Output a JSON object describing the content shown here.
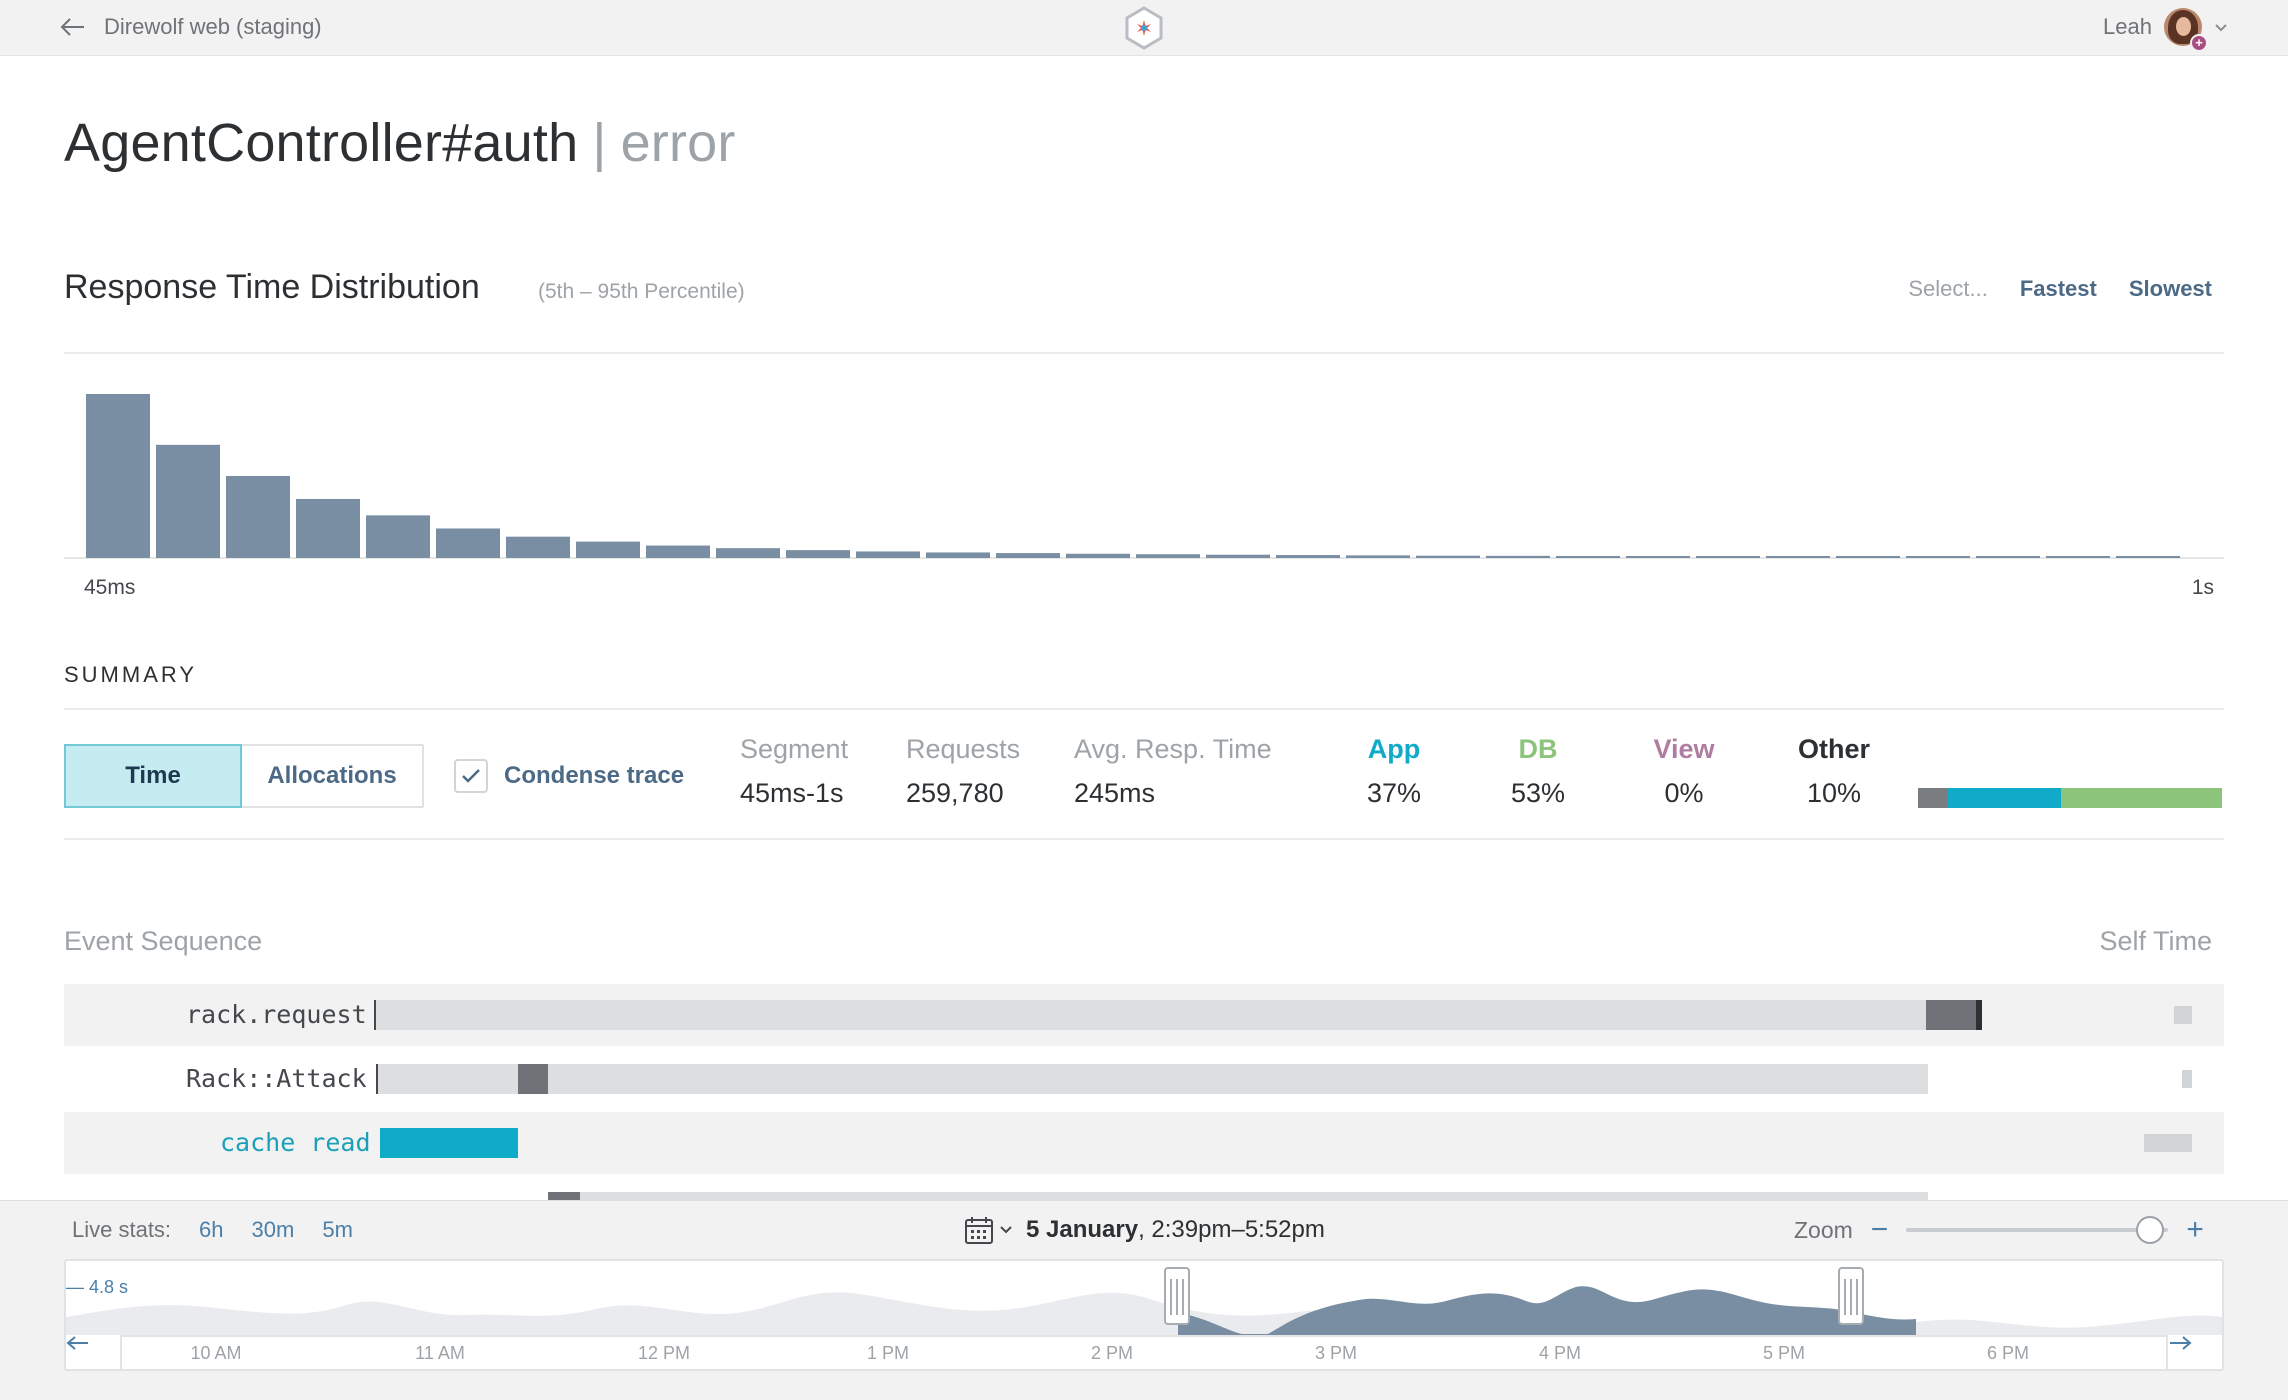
{
  "topbar": {
    "app_name": "Direwolf web (staging)",
    "user_name": "Leah"
  },
  "page": {
    "endpoint": "AgentController#auth",
    "separator": "|",
    "status": "error"
  },
  "distribution": {
    "title": "Response Time Distribution",
    "subtitle": "(5th – 95th Percentile)",
    "select_label": "Select...",
    "fastest_label": "Fastest",
    "slowest_label": "Slowest",
    "min_label": "45ms",
    "max_label": "1s"
  },
  "chart_data": {
    "type": "bar",
    "title": "Response Time Distribution",
    "x_start_label": "45ms",
    "x_end_label": "1s",
    "values": [
      100,
      69,
      50,
      36,
      26,
      18,
      13,
      10,
      7.6,
      6,
      4.8,
      4,
      3.4,
      3,
      2.6,
      2.3,
      2,
      1.8,
      1.6,
      1.4,
      1.3,
      1.2,
      1.1,
      1,
      0.9,
      0.8,
      0.7,
      0.6,
      0.6,
      0.5
    ],
    "bar_color": "#7a8ea3"
  },
  "summary": {
    "title": "SUMMARY",
    "toggle": {
      "time": "Time",
      "allocations": "Allocations"
    },
    "condense_trace": "Condense trace",
    "stats": {
      "segment": {
        "label": "Segment",
        "value": "45ms-1s"
      },
      "requests": {
        "label": "Requests",
        "value": "259,780"
      },
      "avg": {
        "label": "Avg. Resp. Time",
        "value": "245ms"
      },
      "app": {
        "label": "App",
        "value": "37%"
      },
      "db": {
        "label": "DB",
        "value": "53%"
      },
      "view": {
        "label": "View",
        "value": "0%"
      },
      "other": {
        "label": "Other",
        "value": "10%"
      }
    },
    "colors": {
      "app": "#10abc8",
      "db": "#8dc47b",
      "view": "#b07da0",
      "other": "#797c81"
    },
    "breakdown": {
      "other": 10,
      "app": 37,
      "db": 53
    }
  },
  "events": {
    "header_left": "Event Sequence",
    "header_right": "Self Time",
    "rows": [
      {
        "label": "rack.request"
      },
      {
        "label": "Rack::Attack"
      },
      {
        "label": "cache read"
      }
    ]
  },
  "timebar": {
    "live_label": "Live stats:",
    "options": [
      "6h",
      "30m",
      "5m"
    ],
    "date_bold": "5 January",
    "date_range": ", 2:39pm–5:52pm",
    "zoom_label": "Zoom",
    "zoom_minus": "−",
    "zoom_plus": "+",
    "y_max": "— 4.8 s",
    "ticks": [
      "10 AM",
      "11 AM",
      "12 PM",
      "1 PM",
      "2 PM",
      "3 PM",
      "4 PM",
      "5 PM",
      "6 PM"
    ]
  }
}
